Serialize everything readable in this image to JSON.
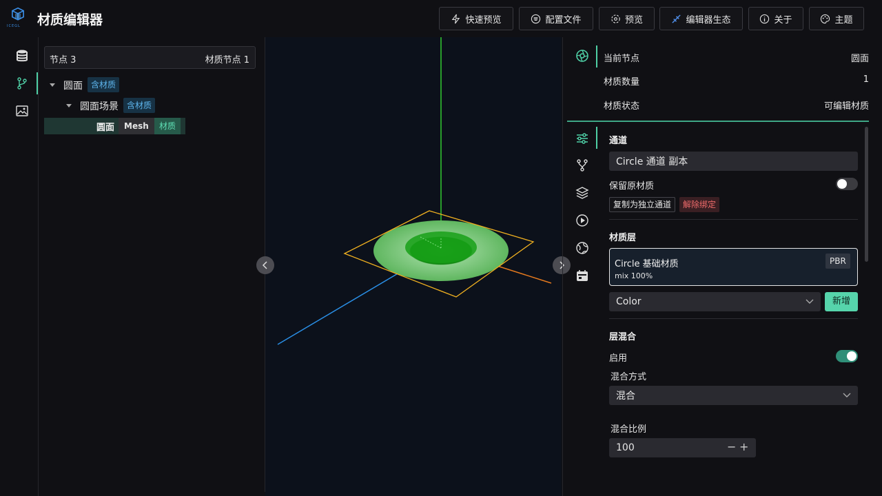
{
  "app": {
    "title": "材质编辑器",
    "logo_text": "ICEGL"
  },
  "header_buttons": [
    {
      "label": "快速预览",
      "icon": "lightning-icon"
    },
    {
      "label": "配置文件",
      "icon": "config-icon"
    },
    {
      "label": "预览",
      "icon": "preview-icon"
    },
    {
      "label": "编辑器生态",
      "icon": "ecosystem-icon"
    },
    {
      "label": "关于",
      "icon": "info-icon"
    },
    {
      "label": "主题",
      "icon": "palette-icon"
    }
  ],
  "left_sidebar": {
    "icons": [
      "database-icon",
      "branch-icon",
      "image-icon"
    ],
    "active_index": 1
  },
  "tree": {
    "header_left": "节点 3",
    "header_right": "材质节点 1",
    "rows": [
      {
        "label": "圆面",
        "tag": "含材质"
      },
      {
        "label": "圆面场景",
        "tag": "含材质"
      },
      {
        "label": "圆面",
        "tag1": "Mesh",
        "tag2": "材质"
      }
    ]
  },
  "info": {
    "current_node_label": "当前节点",
    "current_node_value": "圆面",
    "count_label": "材质数量",
    "count_value": "1",
    "status_label": "材质状态",
    "status_value": "可编辑材质"
  },
  "right_sidebar": {
    "icons": [
      "sliders-icon",
      "branch-icon",
      "layers-icon",
      "play-icon",
      "globe-icon",
      "calendar-icon"
    ],
    "active_index": 0
  },
  "channel": {
    "title": "通道",
    "name_value": "Circle 通道 副本",
    "keep_label": "保留原材质",
    "keep_on": false,
    "copy_button": "复制为独立通道",
    "unbind_button": "解除绑定"
  },
  "layers": {
    "title": "材质层",
    "card_name": "Circle 基础材质",
    "card_badge": "PBR",
    "card_mix": "mix 100%",
    "select_value": "Color",
    "add_button": "新增"
  },
  "blend": {
    "title": "层混合",
    "enable_label": "启用",
    "enable_on": true,
    "mode_label": "混合方式",
    "mode_value": "混合",
    "ratio_label": "混合比例",
    "ratio_value": "100"
  },
  "colors": {
    "accent": "#4fd0a6",
    "tag_blue": "#5eb6ee",
    "danger": "#ef6b6b",
    "toggle_on": "#2f8f78"
  }
}
